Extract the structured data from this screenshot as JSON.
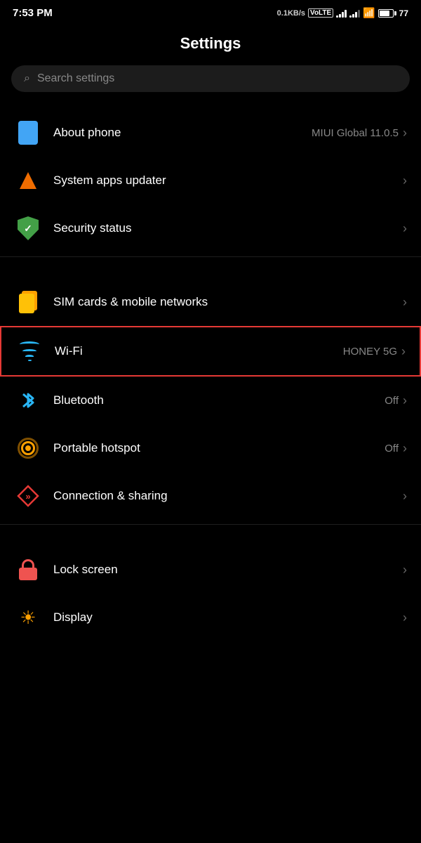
{
  "statusBar": {
    "time": "7:53 PM",
    "speed": "0.1KB/s",
    "network_type": "VoLTE",
    "battery_pct": 77
  },
  "page": {
    "title": "Settings"
  },
  "search": {
    "placeholder": "Search settings"
  },
  "items": [
    {
      "id": "about-phone",
      "label": "About phone",
      "sub": "MIUI Global 11.0.5",
      "icon": "phone-icon",
      "chevron": "›"
    },
    {
      "id": "system-apps-updater",
      "label": "System apps updater",
      "sub": "",
      "icon": "update-icon",
      "chevron": "›"
    },
    {
      "id": "security-status",
      "label": "Security status",
      "sub": "",
      "icon": "shield-icon",
      "chevron": "›"
    },
    {
      "id": "sim-cards",
      "label": "SIM cards & mobile networks",
      "sub": "",
      "icon": "sim-icon",
      "chevron": "›"
    },
    {
      "id": "wifi",
      "label": "Wi-Fi",
      "sub": "HONEY 5G",
      "icon": "wifi-icon",
      "chevron": "›",
      "highlighted": true
    },
    {
      "id": "bluetooth",
      "label": "Bluetooth",
      "sub": "Off",
      "icon": "bluetooth-icon",
      "chevron": "›"
    },
    {
      "id": "portable-hotspot",
      "label": "Portable hotspot",
      "sub": "Off",
      "icon": "hotspot-icon",
      "chevron": "›"
    },
    {
      "id": "connection-sharing",
      "label": "Connection & sharing",
      "sub": "",
      "icon": "connection-icon",
      "chevron": "›"
    },
    {
      "id": "lock-screen",
      "label": "Lock screen",
      "sub": "",
      "icon": "lock-icon",
      "chevron": "›"
    },
    {
      "id": "display",
      "label": "Display",
      "sub": "",
      "icon": "display-icon",
      "chevron": "›"
    }
  ]
}
